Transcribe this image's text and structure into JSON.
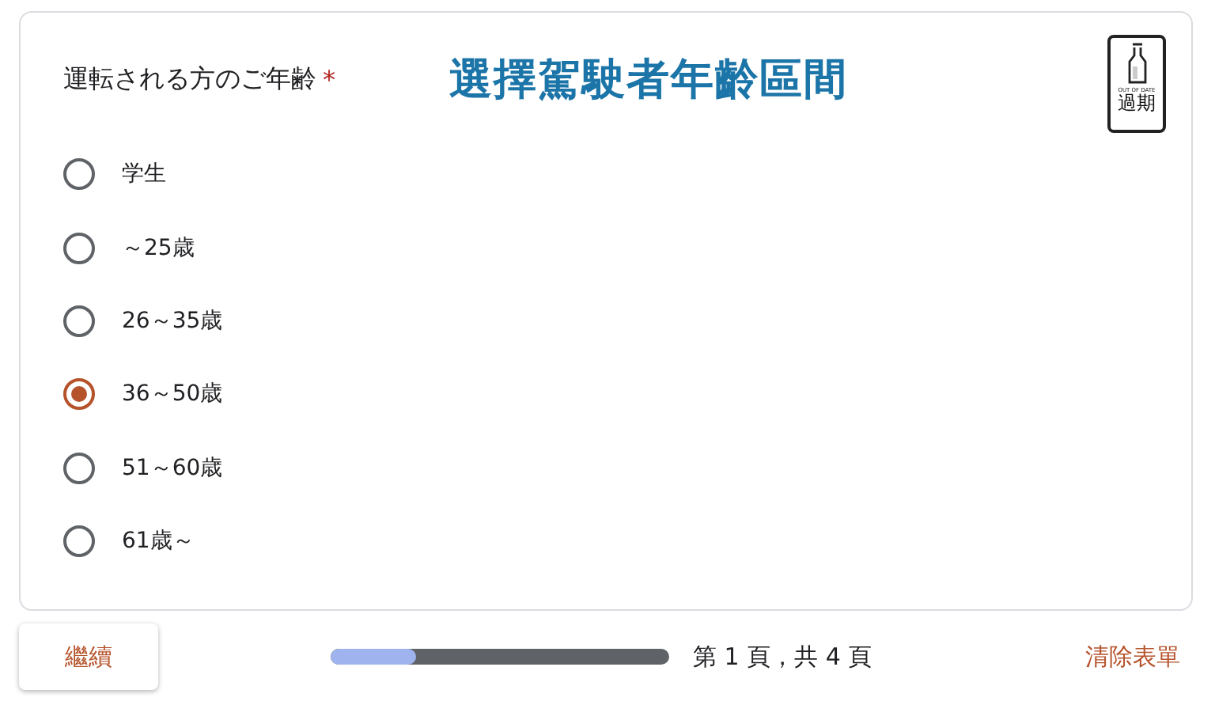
{
  "question": {
    "title": "運転される方のご年齢",
    "required_mark": "*"
  },
  "caption": "選擇駕駛者年齡區間",
  "badge": {
    "subtitle": "OUT OF DATE",
    "label": "過期"
  },
  "options": [
    {
      "label": "学生",
      "selected": false
    },
    {
      "label": "～25歳",
      "selected": false
    },
    {
      "label": "26～35歳",
      "selected": false
    },
    {
      "label": "36～50歳",
      "selected": true
    },
    {
      "label": "51～60歳",
      "selected": false
    },
    {
      "label": "61歳～",
      "selected": false
    }
  ],
  "footer": {
    "next_button": "繼續",
    "progress": {
      "level": 0.25
    },
    "page_text": "第 1 頁，共 4 頁",
    "clear_link": "清除表單"
  }
}
